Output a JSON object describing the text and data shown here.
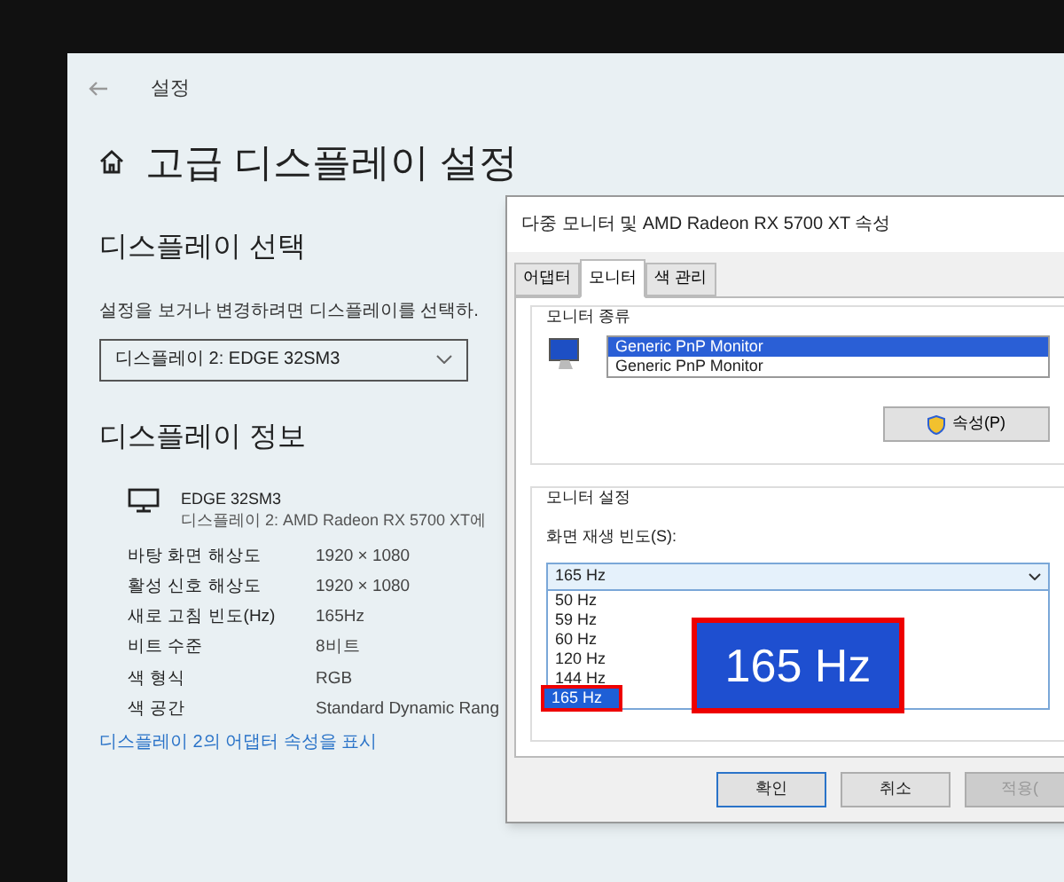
{
  "settings": {
    "title": "설정",
    "heading": "고급 디스플레이 설정",
    "select_section": {
      "heading": "디스플레이 선택",
      "prompt": "설정을 보거나 변경하려면 디스플레이를 선택하.",
      "dropdown": "디스플레이 2: EDGE 32SM3"
    },
    "info_section": {
      "heading": "디스플레이 정보",
      "monitor_name": "EDGE 32SM3",
      "monitor_desc": "디스플레이 2: AMD Radeon RX 5700 XT에",
      "rows": [
        {
          "label": "바탕 화면 해상도",
          "value": "1920 × 1080"
        },
        {
          "label": "활성 신호 해상도",
          "value": "1920 × 1080"
        },
        {
          "label": "새로 고침 빈도(Hz)",
          "value": "165Hz"
        },
        {
          "label": "비트 수준",
          "value": "8비트"
        },
        {
          "label": "색 형식",
          "value": "RGB"
        },
        {
          "label": "색 공간",
          "value": "Standard Dynamic Rang"
        }
      ],
      "link": "디스플레이 2의 어댑터 속성을 표시"
    }
  },
  "dialog": {
    "title": "다중 모니터 및 AMD Radeon RX 5700 XT 속성",
    "tabs": [
      {
        "label": "어댑터",
        "selected": false
      },
      {
        "label": "모니터",
        "selected": true
      },
      {
        "label": "색 관리",
        "selected": false
      }
    ],
    "monitor_type": {
      "legend": "모니터 종류",
      "items": [
        {
          "label": "Generic PnP Monitor",
          "selected": true
        },
        {
          "label": "Generic PnP Monitor",
          "selected": false
        }
      ],
      "button": "속성(P)"
    },
    "monitor_settings": {
      "legend": "모니터 설정",
      "field_label": "화면 재생 빈도(S):",
      "dropdown": "165 Hz",
      "options": [
        {
          "label": "50 Hz",
          "selected": false,
          "annotated": false
        },
        {
          "label": "59 Hz",
          "selected": false,
          "annotated": false
        },
        {
          "label": "60 Hz",
          "selected": false,
          "annotated": false
        },
        {
          "label": "120 Hz",
          "selected": false,
          "annotated": false
        },
        {
          "label": "144 Hz",
          "selected": false,
          "annotated": false
        },
        {
          "label": "165 Hz",
          "selected": true,
          "annotated": true
        }
      ]
    },
    "buttons": [
      {
        "label": "확인",
        "disabled": false,
        "default": true
      },
      {
        "label": "취소",
        "disabled": false,
        "default": false
      },
      {
        "label": "적용(",
        "disabled": true,
        "default": false
      }
    ]
  },
  "magnifier": {
    "text": "165 Hz"
  }
}
